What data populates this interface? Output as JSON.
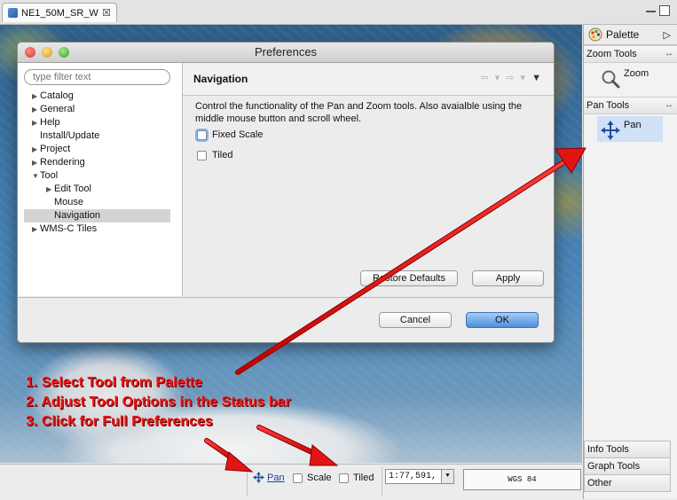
{
  "editor": {
    "tab_label": "NE1_50M_SR_W",
    "tab_close": "☒"
  },
  "dialog": {
    "title": "Preferences",
    "filter_placeholder": "type filter text",
    "tree": [
      {
        "label": "Catalog",
        "expander": "▶"
      },
      {
        "label": "General",
        "expander": "▶"
      },
      {
        "label": "Help",
        "expander": "▶"
      },
      {
        "label": "Install/Update",
        "expander": ""
      },
      {
        "label": "Project",
        "expander": "▶"
      },
      {
        "label": "Rendering",
        "expander": "▶"
      },
      {
        "label": "Tool",
        "expander": "▼"
      },
      {
        "label": "Edit Tool",
        "expander": "▶"
      },
      {
        "label": "Mouse",
        "expander": ""
      },
      {
        "label": "Navigation",
        "expander": ""
      },
      {
        "label": "WMS-C Tiles",
        "expander": "▶"
      }
    ],
    "page": {
      "title": "Navigation",
      "nav": "⇦ ▾ ⇨ ▾",
      "nav_menu": "▼",
      "description": "Control the functionality of the Pan and Zoom tools. Also avaialble using the middle mouse button and scroll wheel.",
      "fixed_scale_label": "Fixed Scale",
      "tiled_label": "Tiled",
      "restore_defaults": "Restore Defaults",
      "apply": "Apply"
    },
    "cancel": "Cancel",
    "ok": "OK"
  },
  "palette": {
    "title": "Palette",
    "expand_arrow": "▷",
    "pin_icon": "↔",
    "zoom_drawer": "Zoom Tools",
    "zoom_tool": "Zoom",
    "pan_drawer": "Pan Tools",
    "pan_tool": "Pan",
    "bottom_drawers": [
      "Info Tools",
      "Graph Tools",
      "Other"
    ]
  },
  "status": {
    "tool": "Pan",
    "scale_option": "Scale",
    "tiled_option": "Tiled",
    "scale_value": "1:77,591,",
    "scale_dropdown": "▼",
    "crs": "WGS 84"
  },
  "annotations": [
    "1. Select Tool from Palette",
    "2. Adjust Tool Options in the Status bar",
    "3. Click for Full Preferences"
  ],
  "colors": {
    "annotation": "#ee1515",
    "primary_button": "#4c8fdb",
    "selection": "#cfe0f7"
  }
}
